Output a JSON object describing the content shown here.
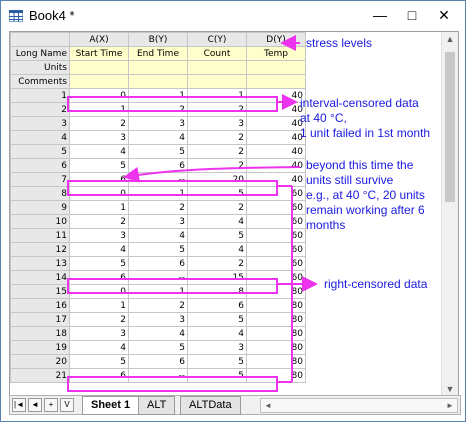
{
  "window": {
    "title": "Book4 *",
    "minimize": "—",
    "maximize": "□",
    "close": "✕"
  },
  "grid": {
    "col_headers": [
      "A(X)",
      "B(Y)",
      "C(Y)",
      "D(Y)"
    ],
    "meta_rows": [
      {
        "label": "Long Name",
        "values": [
          "Start Time",
          "End Time",
          "Count",
          "Temp"
        ]
      },
      {
        "label": "Units",
        "values": [
          "",
          "",
          "",
          ""
        ]
      },
      {
        "label": "Comments",
        "values": [
          "",
          "",
          "",
          ""
        ]
      }
    ],
    "rows": [
      [
        "1",
        "0",
        "1",
        "1",
        "40"
      ],
      [
        "2",
        "1",
        "2",
        "2",
        "40"
      ],
      [
        "3",
        "2",
        "3",
        "3",
        "40"
      ],
      [
        "4",
        "3",
        "4",
        "2",
        "40"
      ],
      [
        "5",
        "4",
        "5",
        "2",
        "40"
      ],
      [
        "6",
        "5",
        "6",
        "2",
        "40"
      ],
      [
        "7",
        "6",
        "--",
        "20",
        "40"
      ],
      [
        "8",
        "0",
        "1",
        "5",
        "60"
      ],
      [
        "9",
        "1",
        "2",
        "2",
        "60"
      ],
      [
        "10",
        "2",
        "3",
        "4",
        "60"
      ],
      [
        "11",
        "3",
        "4",
        "5",
        "60"
      ],
      [
        "12",
        "4",
        "5",
        "4",
        "60"
      ],
      [
        "13",
        "5",
        "6",
        "2",
        "60"
      ],
      [
        "14",
        "6",
        "--",
        "15",
        "60"
      ],
      [
        "15",
        "0",
        "1",
        "8",
        "80"
      ],
      [
        "16",
        "1",
        "2",
        "6",
        "80"
      ],
      [
        "17",
        "2",
        "3",
        "5",
        "80"
      ],
      [
        "18",
        "3",
        "4",
        "4",
        "80"
      ],
      [
        "19",
        "4",
        "5",
        "3",
        "80"
      ],
      [
        "20",
        "5",
        "6",
        "5",
        "80"
      ],
      [
        "21",
        "6",
        "--",
        "5",
        "80"
      ]
    ]
  },
  "tabs": [
    "Sheet 1",
    "ALT",
    "ALTData"
  ],
  "nav": {
    "first": "|◄",
    "prev": "◄",
    "add": "+",
    "menu": "V"
  },
  "annotations": {
    "stress": "stress levels",
    "interval": [
      "interval-censored data",
      "at 40 °C,",
      "1 unit failed in 1st month"
    ],
    "beyond": [
      "beyond this time the",
      "units still survive",
      "e.g., at 40 °C, 20 units",
      "remain working after 6",
      "months"
    ],
    "right": "right-censored data"
  },
  "colors": {
    "accent": "#ee33ee",
    "annotation_text": "#1a1ae0"
  }
}
